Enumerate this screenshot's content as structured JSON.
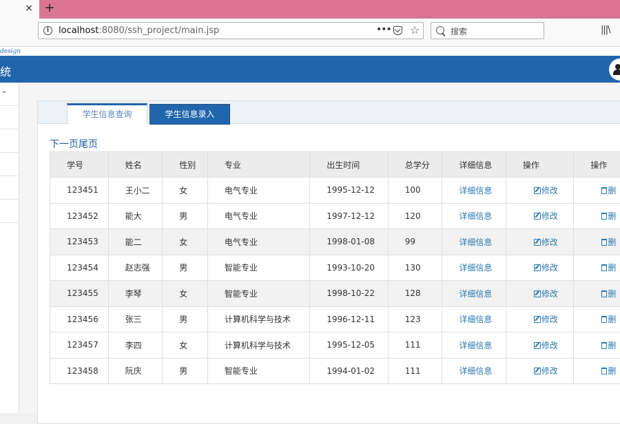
{
  "browser": {
    "tab_close_glyph": "×",
    "new_tab_glyph": "+",
    "url_host": "localhost",
    "url_rest": ":8080/ssh_project/main.jsp",
    "search_placeholder": "搜索",
    "accent_color": "#d97593"
  },
  "app": {
    "logo_fragment": "design",
    "title_fragment": "统",
    "header_color": "#2066ad"
  },
  "tabs": [
    {
      "label": "学生信息查询",
      "active": true
    },
    {
      "label": "学生信息录入",
      "active": false
    }
  ],
  "pager": {
    "next_label": "下一页",
    "last_label": "尾页"
  },
  "table": {
    "columns": [
      "学号",
      "姓名",
      "性别",
      "专业",
      "出生时间",
      "总学分",
      "详细信息",
      "操作",
      "操作"
    ],
    "detail_label": "详细信息",
    "edit_label": "修改",
    "delete_label": "删",
    "rows": [
      {
        "id": "123451",
        "name": "王小二",
        "gender": "女",
        "major": "电气专业",
        "birth": "1995-12-12",
        "credits": "100"
      },
      {
        "id": "123452",
        "name": "能大",
        "gender": "男",
        "major": "电气专业",
        "birth": "1997-12-12",
        "credits": "120"
      },
      {
        "id": "123453",
        "name": "能二",
        "gender": "女",
        "major": "电气专业",
        "birth": "1998-01-08",
        "credits": "99"
      },
      {
        "id": "123454",
        "name": "赵志强",
        "gender": "男",
        "major": "智能专业",
        "birth": "1993-10-20",
        "credits": "130"
      },
      {
        "id": "123455",
        "name": "李琴",
        "gender": "女",
        "major": "智能专业",
        "birth": "1998-10-22",
        "credits": "128"
      },
      {
        "id": "123456",
        "name": "张三",
        "gender": "男",
        "major": "计算机科学与技术",
        "birth": "1996-12-11",
        "credits": "123"
      },
      {
        "id": "123457",
        "name": "李四",
        "gender": "女",
        "major": "计算机科学与技术",
        "birth": "1995-12-05",
        "credits": "111"
      },
      {
        "id": "123458",
        "name": "阮庆",
        "gender": "男",
        "major": "智能专业",
        "birth": "1994-01-02",
        "credits": "111"
      }
    ]
  }
}
